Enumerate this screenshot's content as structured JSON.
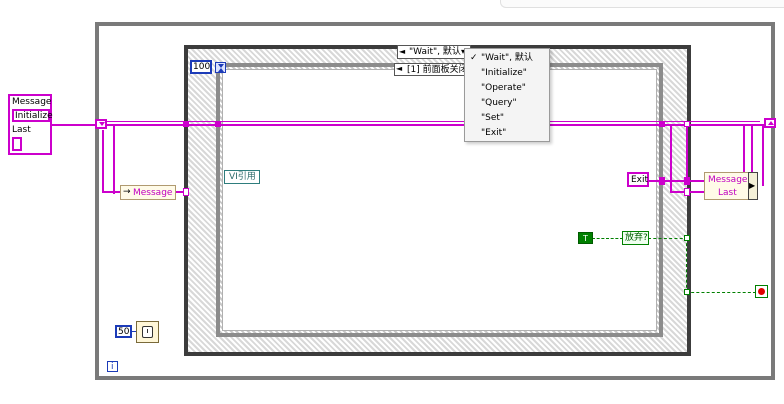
{
  "cluster": {
    "title": "Message",
    "items": [
      "Initialize",
      "Last"
    ]
  },
  "message_unbundle": "Message",
  "loop_count": "100",
  "case_selector": {
    "value": "\"Wait\", 默认",
    "options": [
      "\"Wait\", 默认",
      "\"Initialize\"",
      "\"Operate\"",
      "\"Query\"",
      "\"Set\"",
      "\"Exit\""
    ],
    "selected_index": 0
  },
  "event_selector": "[1] 前面板关闭?",
  "vi_ref": "VI引用",
  "exit_constant": "Exit",
  "bundle_right": [
    "Message",
    "Last"
  ],
  "true_constant": "T",
  "discard_label": "放弃?",
  "timeout_value": "50",
  "iteration_terminal": "i",
  "colors": {
    "wire_pink": "#cc00cc",
    "wire_green": "#008000",
    "loop_border": "#6e6e6e",
    "terminal_blue": "#1c3bb8",
    "stop_red": "#e00000"
  }
}
